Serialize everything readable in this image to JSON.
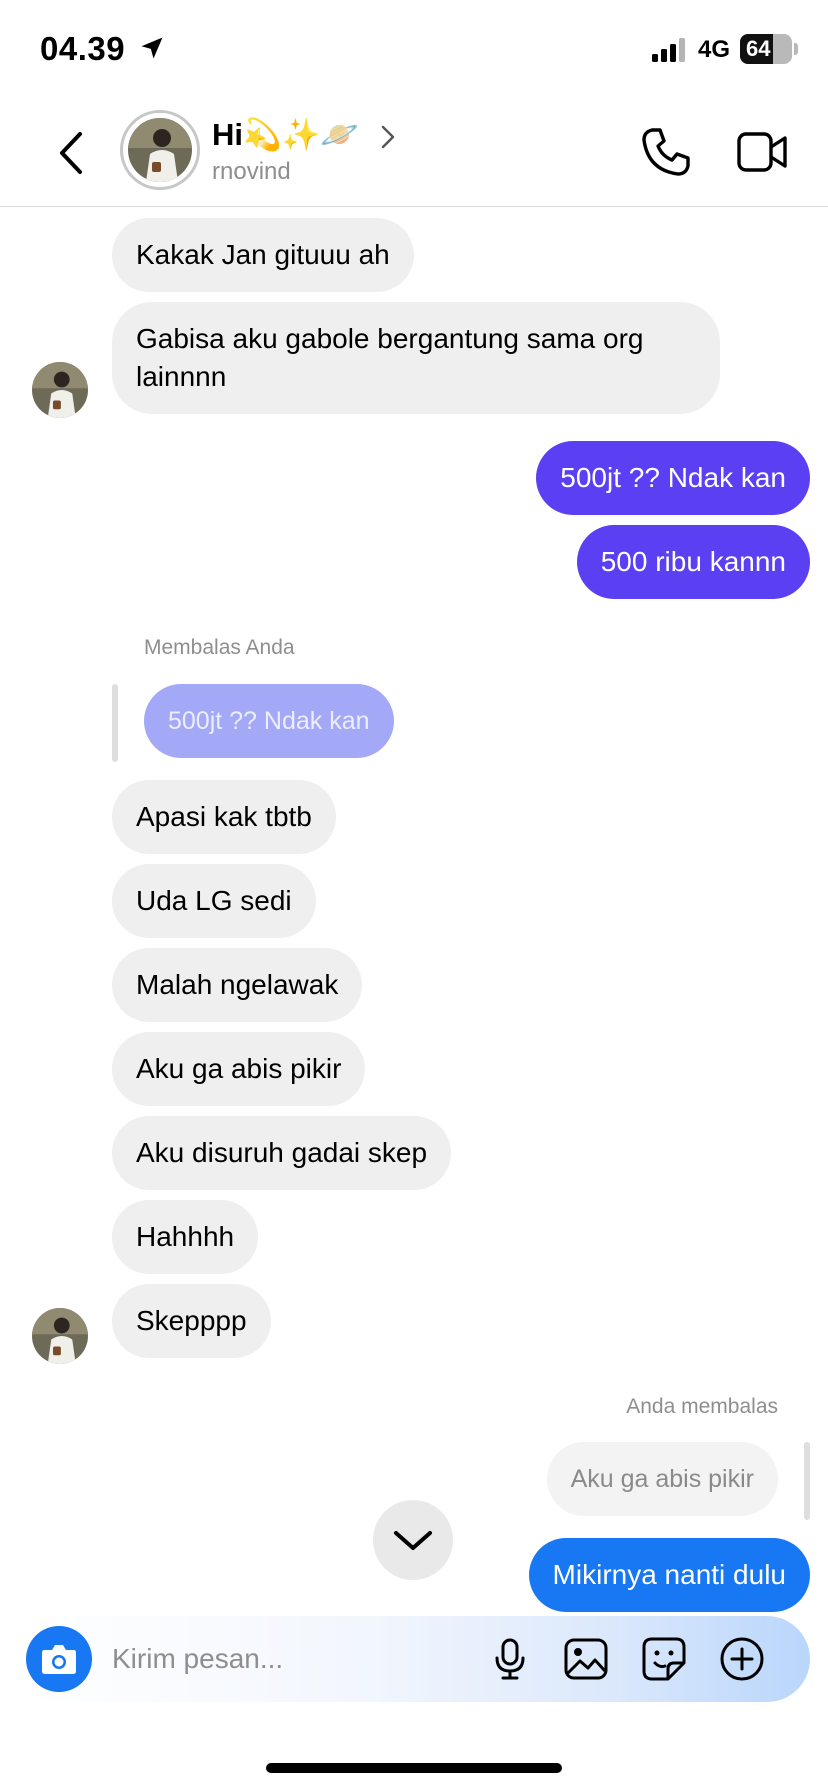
{
  "status_bar": {
    "time": "04.39",
    "network": "4G",
    "battery": "64",
    "battery_level": 0.64
  },
  "header": {
    "title": "Hi💫✨🪐",
    "username": "rnovind",
    "icons": [
      "back-chevron-icon",
      "phone-icon",
      "video-camera-icon",
      "chevron-right-icon"
    ]
  },
  "messages": [
    {
      "from": "them",
      "text": "Kakak Jan gituuu ah"
    },
    {
      "from": "them",
      "text": "Gabisa aku gabole bergantung sama org lainnnn"
    },
    {
      "from": "me",
      "text": "500jt ?? Ndak kan"
    },
    {
      "from": "me",
      "text": "500 ribu kannn"
    },
    {
      "from": "them",
      "reply_label": "Membalas Anda",
      "quoted": "500jt ?? Ndak kan",
      "text": "Apasi kak tbtb"
    },
    {
      "from": "them",
      "text": "Uda LG sedi"
    },
    {
      "from": "them",
      "text": "Malah ngelawak"
    },
    {
      "from": "them",
      "text": "Aku ga abis pikir"
    },
    {
      "from": "them",
      "text": "Aku disuruh gadai skep"
    },
    {
      "from": "them",
      "text": "Hahhhh"
    },
    {
      "from": "them",
      "text": "Skepppp"
    },
    {
      "from": "me",
      "reply_label": "Anda membalas",
      "quoted": "Aku ga abis pikir",
      "text": "Mikirnya nanti dulu"
    }
  ],
  "composer": {
    "placeholder": "Kirim pesan...",
    "icons": [
      "camera-icon",
      "microphone-icon",
      "gallery-icon",
      "sticker-icon",
      "plus-icon"
    ]
  },
  "colors": {
    "outgoing_purple": "#5b3ff3",
    "outgoing_blue": "#1877f2",
    "incoming_gray": "#efefef",
    "quoted_purple": "#a3a8f7"
  }
}
